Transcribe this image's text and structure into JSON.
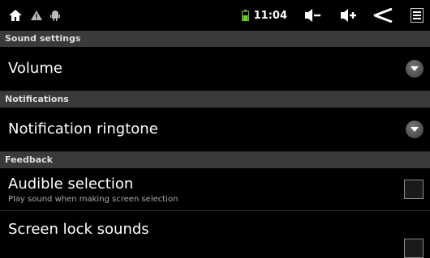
{
  "status_bar": {
    "time": "11:04",
    "icons": [
      "home-icon",
      "warning-icon",
      "android-icon",
      "battery-icon",
      "volume-down-icon",
      "volume-up-icon",
      "back-icon",
      "menu-icon"
    ]
  },
  "sections": [
    {
      "header": "Sound settings",
      "items": [
        {
          "title": "Volume",
          "control": "chevron"
        }
      ]
    },
    {
      "header": "Notifications",
      "items": [
        {
          "title": "Notification ringtone",
          "control": "chevron"
        }
      ]
    },
    {
      "header": "Feedback",
      "items": [
        {
          "title": "Audible selection",
          "subtitle": "Play sound when making screen selection",
          "control": "checkbox",
          "checked": false
        },
        {
          "title": "Screen lock sounds",
          "control": "checkbox",
          "checked": false
        }
      ]
    }
  ]
}
